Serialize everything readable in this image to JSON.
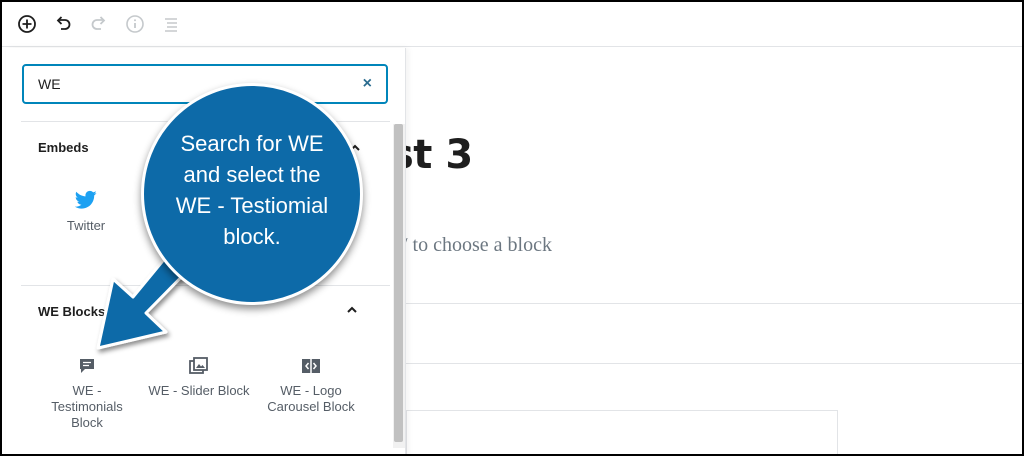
{
  "toolbar": {
    "buttons": [
      {
        "name": "add-block",
        "icon": "plus-circle-icon"
      },
      {
        "name": "undo",
        "icon": "undo-icon"
      },
      {
        "name": "redo",
        "icon": "redo-icon"
      },
      {
        "name": "info",
        "icon": "info-icon"
      },
      {
        "name": "outline",
        "icon": "list-icon"
      }
    ]
  },
  "search": {
    "value": "WE",
    "clear_glyph": "×"
  },
  "sections": {
    "embeds": {
      "title": "Embeds",
      "items": [
        {
          "label": "Twitter",
          "icon": "twitter-icon"
        }
      ]
    },
    "we_blocks": {
      "title": "WE Blocks",
      "items": [
        {
          "label": "WE - Testimonials Block",
          "icon": "comment-icon"
        },
        {
          "label": "WE - Slider Block",
          "icon": "gallery-icon"
        },
        {
          "label": "WE - Logo Carousel Block",
          "icon": "carousel-icon"
        }
      ]
    }
  },
  "editor": {
    "title_fragment": "st 3",
    "placeholder": "/ to choose a block"
  },
  "callout": {
    "text": "Search for WE and select the WE - Testiomial block.",
    "color": "#0d6aa8"
  },
  "colors": {
    "accent": "#0085ba",
    "twitter": "#1da1f2"
  }
}
